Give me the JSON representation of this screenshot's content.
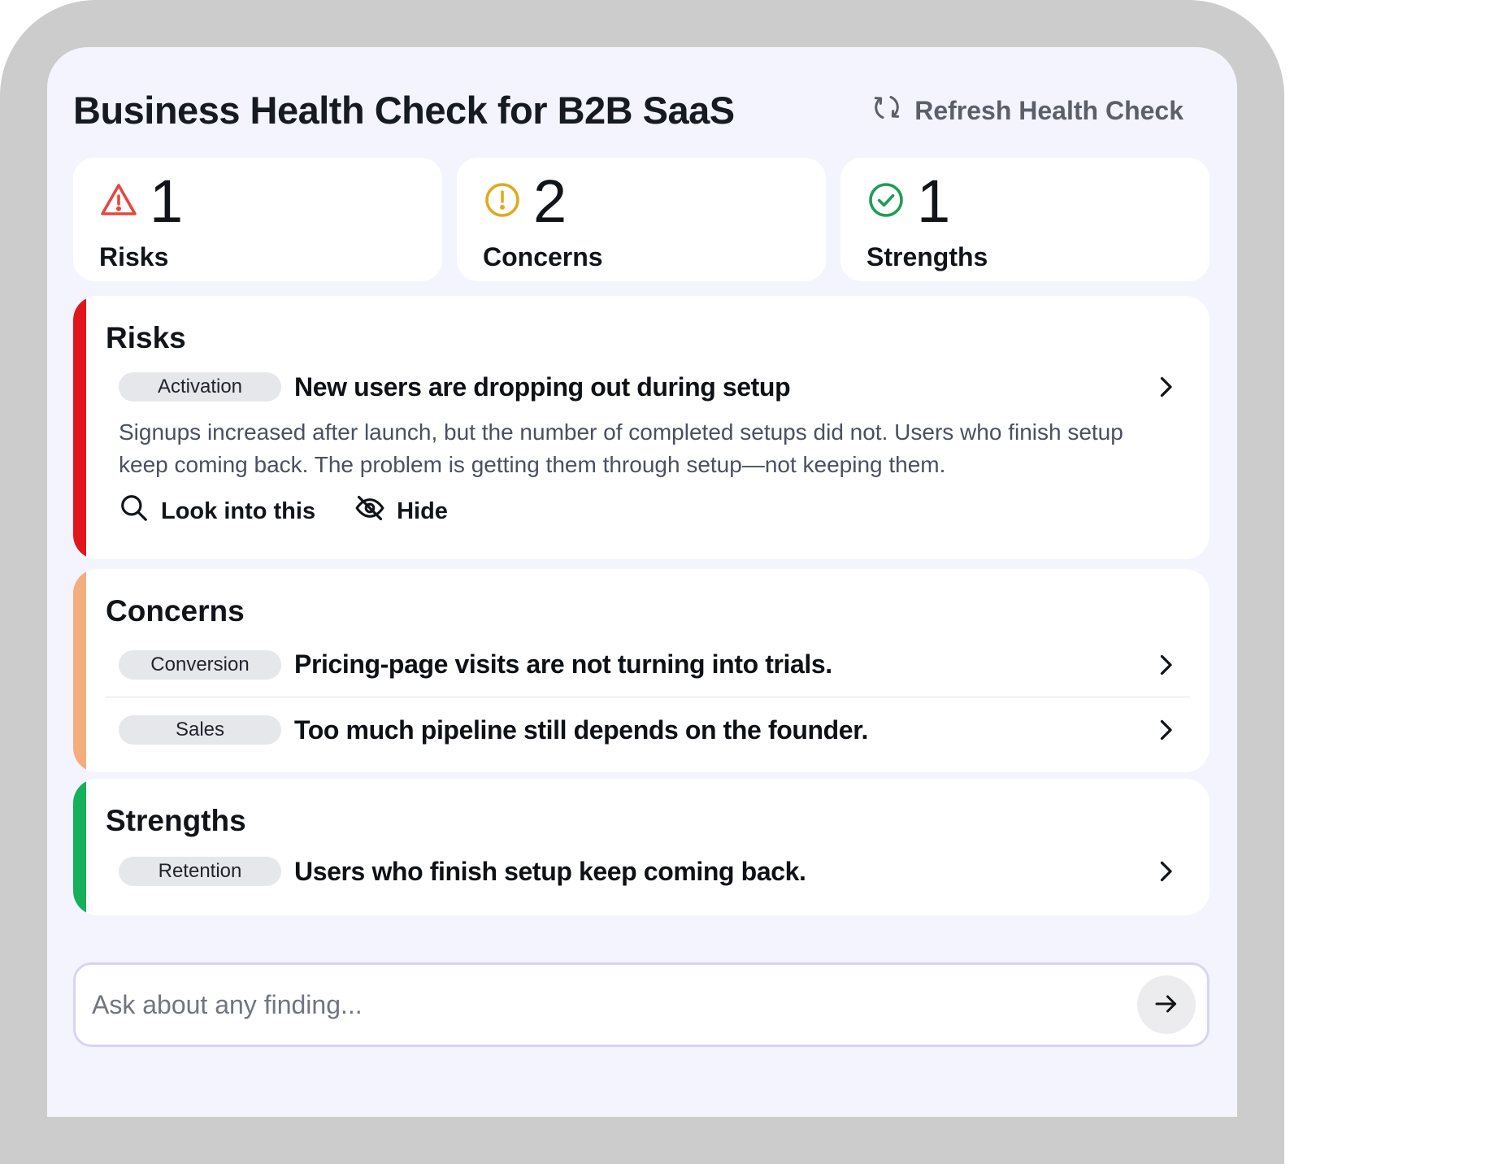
{
  "header": {
    "title": "Business Health Check for B2B SaaS",
    "refresh_label": "Refresh Health Check"
  },
  "summary": [
    {
      "count": "1",
      "label": "Risks",
      "icon": "warning-triangle-icon",
      "color": "#e5483e"
    },
    {
      "count": "2",
      "label": "Concerns",
      "icon": "exclamation-circle-icon",
      "color": "#e1a91f"
    },
    {
      "count": "1",
      "label": "Strengths",
      "icon": "check-circle-icon",
      "color": "#1f9d55"
    }
  ],
  "sections": {
    "risks": {
      "title": "Risks",
      "accent": "#e0161c",
      "items": [
        {
          "tag": "Activation",
          "title": "New users are dropping out during setup",
          "description": "Signups increased after launch, but the number of completed setups did not. Users who finish setup keep coming back. The problem is getting them through setup—not keeping them.",
          "actions": {
            "look": "Look into this",
            "hide": "Hide"
          }
        }
      ]
    },
    "concerns": {
      "title": "Concerns",
      "accent": "#f4ad7d",
      "items": [
        {
          "tag": "Conversion",
          "title": "Pricing-page visits are not turning into trials."
        },
        {
          "tag": "Sales",
          "title": "Too much pipeline still depends on the founder."
        }
      ]
    },
    "strengths": {
      "title": "Strengths",
      "accent": "#14b05a",
      "items": [
        {
          "tag": "Retention",
          "title": "Users who finish setup keep coming back."
        }
      ]
    }
  },
  "ask": {
    "placeholder": "Ask about any finding..."
  }
}
